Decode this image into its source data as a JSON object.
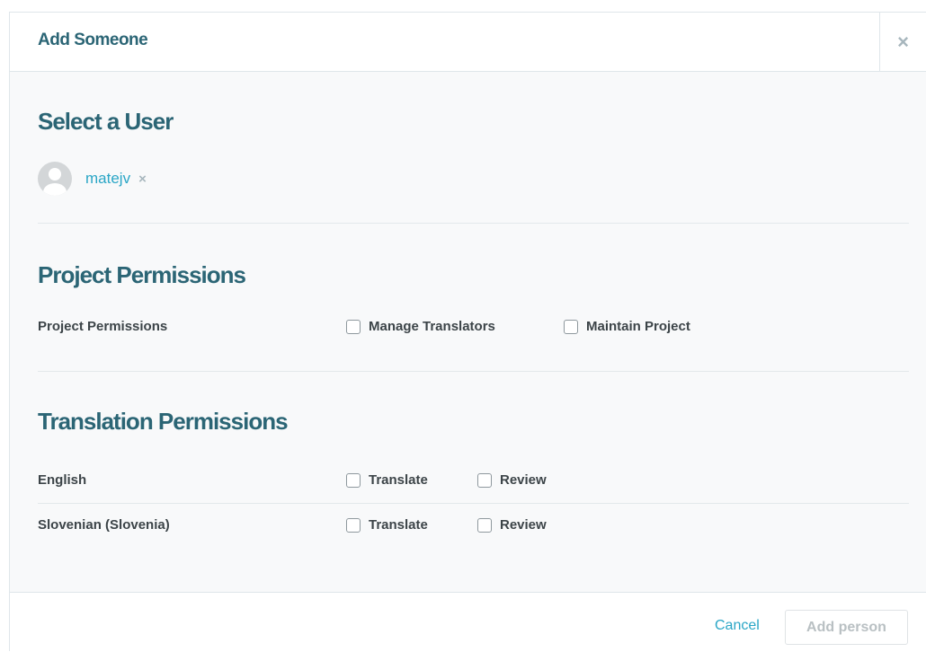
{
  "header": {
    "title": "Add Someone",
    "close_symbol": "×"
  },
  "select_user": {
    "title": "Select a User",
    "user": {
      "name": "matejv",
      "avatar_icon": "user-avatar-icon",
      "remove_symbol": "×"
    }
  },
  "project_permissions": {
    "title": "Project Permissions",
    "row_label": "Project Permissions",
    "options": [
      {
        "label": "Manage Translators",
        "checked": false
      },
      {
        "label": "Maintain Project",
        "checked": false
      }
    ]
  },
  "translation_permissions": {
    "title": "Translation Permissions",
    "languages": [
      {
        "name": "English",
        "options": [
          {
            "label": "Translate",
            "checked": false
          },
          {
            "label": "Review",
            "checked": false
          }
        ]
      },
      {
        "name": "Slovenian (Slovenia)",
        "options": [
          {
            "label": "Translate",
            "checked": false
          },
          {
            "label": "Review",
            "checked": false
          }
        ]
      }
    ]
  },
  "footer": {
    "cancel_label": "Cancel",
    "add_label": "Add person"
  },
  "colors": {
    "heading": "#2b6575",
    "link": "#2aa6c6",
    "muted": "#a7b6bd",
    "border": "#dfe6ea"
  }
}
